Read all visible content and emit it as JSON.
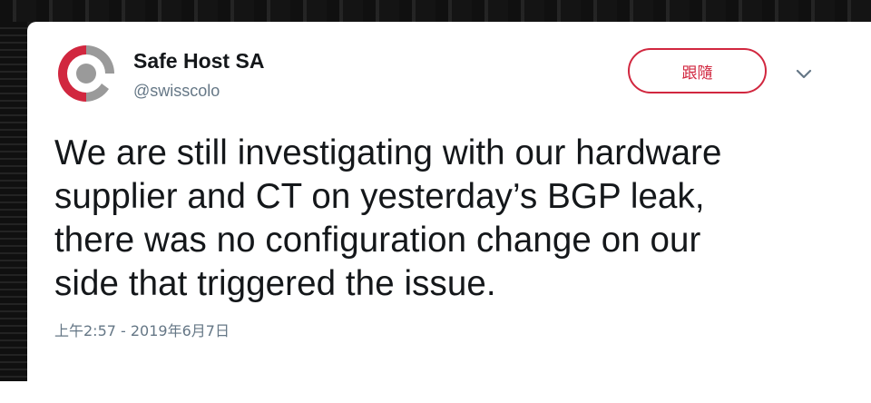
{
  "tweet": {
    "author": {
      "display_name": "Safe Host SA",
      "handle": "@swisscolo",
      "avatar_icon": "safe-host-logo-icon",
      "brand_colors": {
        "red": "#d1273f",
        "gray": "#9a9a9a"
      }
    },
    "follow_label": "跟隨",
    "menu_icon": "chevron-down-icon",
    "text_lines": [
      "We are still investigating with our hardware",
      "supplier and CT on yesterday’s BGP leak,",
      "there was no configuration change on our",
      "side that triggered the issue."
    ],
    "timestamp": "上午2:57 - 2019年6月7日"
  },
  "colors": {
    "accent": "#d1273f",
    "text_primary": "#14171a",
    "text_secondary": "#657786",
    "card_bg": "#ffffff",
    "page_bg": "#1a1a1a"
  }
}
